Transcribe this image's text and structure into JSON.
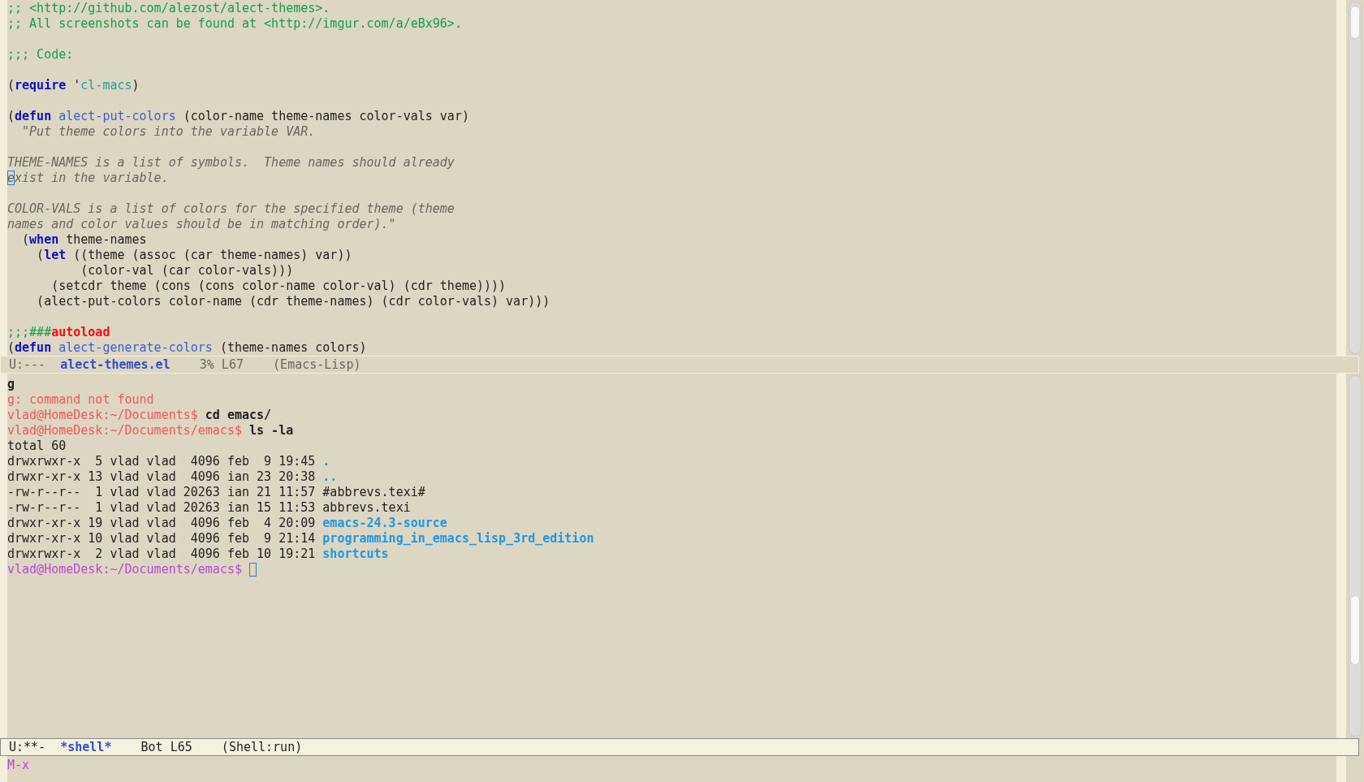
{
  "editor_pane": {
    "lines": [
      {
        "segments": [
          {
            "kind": "comment",
            "text": ";; <http://github.com/alezost/alect-themes>."
          }
        ]
      },
      {
        "segments": [
          {
            "kind": "comment",
            "text": ";; All screenshots can be found at <http://imgur.com/a/eBx96>."
          }
        ]
      },
      {
        "kind": "blank"
      },
      {
        "segments": [
          {
            "kind": "comment",
            "text": ";;; Code:"
          }
        ]
      },
      {
        "kind": "blank"
      },
      {
        "segments": [
          {
            "kind": "plain",
            "text": "("
          },
          {
            "kind": "keyword",
            "text": "require"
          },
          {
            "kind": "plain",
            "text": " '"
          },
          {
            "kind": "constant",
            "text": "cl-macs"
          },
          {
            "kind": "plain",
            "text": ")"
          }
        ]
      },
      {
        "kind": "blank"
      },
      {
        "segments": [
          {
            "kind": "plain",
            "text": "("
          },
          {
            "kind": "keyword",
            "text": "defun"
          },
          {
            "kind": "function",
            "text": " alect-put-colors"
          },
          {
            "kind": "plain",
            "text": " (color-name theme-names color-vals var)"
          }
        ]
      },
      {
        "segments": [
          {
            "kind": "doc",
            "text": "  \"Put theme colors into the variable VAR."
          }
        ]
      },
      {
        "kind": "blank"
      },
      {
        "segments": [
          {
            "kind": "doc",
            "text": "THEME-NAMES is a list of symbols.  Theme names should already"
          }
        ]
      },
      {
        "segments": [
          {
            "kind": "cursor",
            "text": "e"
          },
          {
            "kind": "doc",
            "text": "xist in the variable."
          }
        ]
      },
      {
        "kind": "blank"
      },
      {
        "segments": [
          {
            "kind": "doc",
            "text": "COLOR-VALS is a list of colors for the specified theme (theme"
          }
        ]
      },
      {
        "segments": [
          {
            "kind": "doc",
            "text": "names and color values should be in matching order).\""
          }
        ]
      },
      {
        "segments": [
          {
            "kind": "plain",
            "text": "  ("
          },
          {
            "kind": "keyword",
            "text": "when"
          },
          {
            "kind": "plain",
            "text": " theme-names"
          }
        ]
      },
      {
        "segments": [
          {
            "kind": "plain",
            "text": "    ("
          },
          {
            "kind": "keyword",
            "text": "let"
          },
          {
            "kind": "plain",
            "text": " ((theme (assoc (car theme-names) var))"
          }
        ]
      },
      {
        "segments": [
          {
            "kind": "plain",
            "text": "          (color-val (car color-vals)))"
          }
        ]
      },
      {
        "segments": [
          {
            "kind": "plain",
            "text": "      (setcdr theme (cons (cons color-name color-val) (cdr theme))))"
          }
        ]
      },
      {
        "segments": [
          {
            "kind": "plain",
            "text": "    (alect-put-colors color-name (cdr theme-names) (cdr color-vals) var)))"
          }
        ]
      },
      {
        "kind": "blank"
      },
      {
        "segments": [
          {
            "kind": "comment",
            "text": ";;;###"
          },
          {
            "kind": "warning",
            "text": "autoload"
          }
        ]
      },
      {
        "segments": [
          {
            "kind": "plain",
            "text": "("
          },
          {
            "kind": "keyword",
            "text": "defun"
          },
          {
            "kind": "function",
            "text": " alect-generate-colors"
          },
          {
            "kind": "plain",
            "text": " (theme-names colors)"
          }
        ]
      }
    ]
  },
  "editor_mode_line": {
    "active": false,
    "fields": [
      {
        "kind": "state",
        "text": "U:---"
      },
      {
        "kind": "buffer",
        "text": "alect-themes.el"
      },
      {
        "kind": "position",
        "text": "3% L67"
      },
      {
        "kind": "mode",
        "text": "(Emacs-Lisp)"
      }
    ]
  },
  "shell_pane": {
    "lines": [
      {
        "segments": [
          {
            "kind": "command",
            "text": "g"
          }
        ]
      },
      {
        "segments": [
          {
            "kind": "error",
            "text": "g: command not found"
          }
        ]
      },
      {
        "segments": [
          {
            "kind": "prompt",
            "text": "vlad@HomeDesk:~/Documents$ "
          },
          {
            "kind": "command",
            "text": "cd emacs/"
          }
        ]
      },
      {
        "segments": [
          {
            "kind": "prompt",
            "text": "vlad@HomeDesk:~/Documents/emacs$ "
          },
          {
            "kind": "command",
            "text": "ls -la"
          }
        ]
      },
      {
        "segments": [
          {
            "kind": "plain",
            "text": "total 60"
          }
        ]
      },
      {
        "segments": [
          {
            "kind": "plain",
            "text": "drwxrwxr-x  5 vlad vlad  4096 feb  9 19:45 "
          },
          {
            "kind": "dir",
            "text": "."
          }
        ]
      },
      {
        "segments": [
          {
            "kind": "plain",
            "text": "drwxr-xr-x 13 vlad vlad  4096 ian 23 20:38 "
          },
          {
            "kind": "dir",
            "text": ".."
          }
        ]
      },
      {
        "segments": [
          {
            "kind": "plain",
            "text": "-rw-r--r--  1 vlad vlad 20263 ian 21 11:57 #abbrevs.texi#"
          }
        ]
      },
      {
        "segments": [
          {
            "kind": "plain",
            "text": "-rw-r--r--  1 vlad vlad 20263 ian 15 11:53 abbrevs.texi"
          }
        ]
      },
      {
        "segments": [
          {
            "kind": "plain",
            "text": "drwxr-xr-x 19 vlad vlad  4096 feb  4 20:09 "
          },
          {
            "kind": "dir",
            "text": "emacs-24.3-source"
          }
        ]
      },
      {
        "segments": [
          {
            "kind": "plain",
            "text": "drwxr-xr-x 10 vlad vlad  4096 feb  9 21:14 "
          },
          {
            "kind": "dir",
            "text": "programming_in_emacs_lisp_3rd_edition"
          }
        ]
      },
      {
        "segments": [
          {
            "kind": "plain",
            "text": "drwxrwxr-x  2 vlad vlad  4096 feb 10 19:21 "
          },
          {
            "kind": "dir",
            "text": "shortcuts"
          }
        ]
      },
      {
        "segments": [
          {
            "kind": "current-prompt",
            "text": "vlad@HomeDesk:~/Documents/emacs$"
          }
        ],
        "cursor": true
      }
    ]
  },
  "shell_mode_line": {
    "active": true,
    "fields": [
      {
        "kind": "state",
        "text": "U:**-"
      },
      {
        "kind": "buffer",
        "text": "*shell*"
      },
      {
        "kind": "position",
        "text": "Bot L65"
      },
      {
        "kind": "mode",
        "text": "(Shell:run)"
      }
    ]
  },
  "minibuffer": {
    "text": "M-x"
  }
}
